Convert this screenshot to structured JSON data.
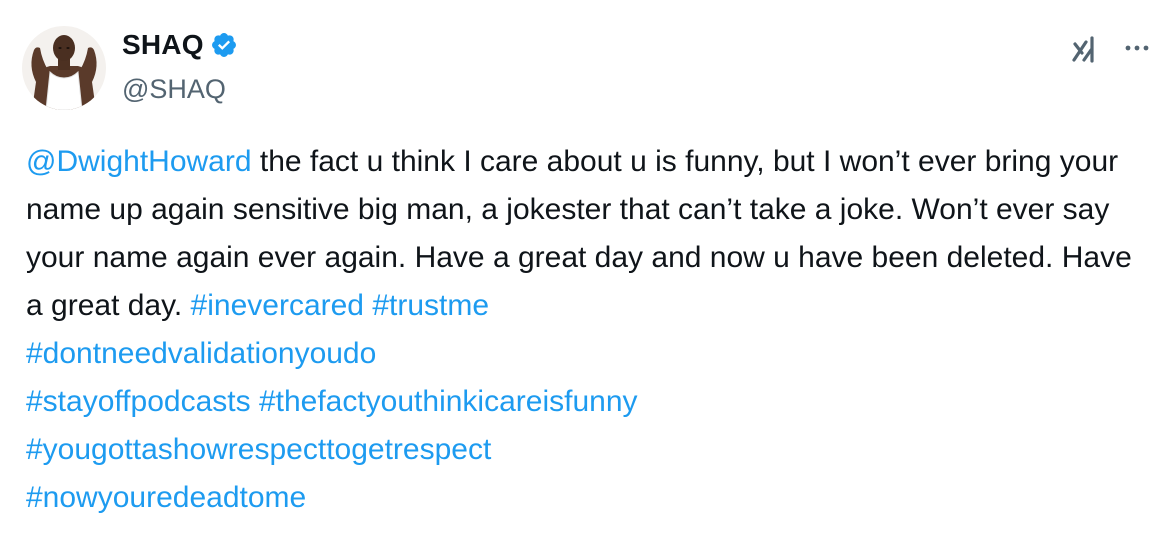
{
  "author": {
    "display_name": "SHAQ",
    "handle": "@SHAQ",
    "verified": true
  },
  "colors": {
    "link": "#1d9bf0",
    "verified": "#1d9bf0",
    "text": "#0f1419",
    "secondary": "#536471"
  },
  "icons": {
    "top_right": [
      "grok-icon",
      "more-icon"
    ],
    "badge": "verified-badge-icon"
  },
  "tweet": {
    "mention": "@DwightHoward",
    "text": " the fact u think I care about u is funny, but I won’t ever bring your name up again sensitive big man, a jokester that can’t take a joke. Won’t ever say your name again ever again. Have a great day and now u have been deleted. Have a great day. ",
    "hashtags": [
      "#inevercared",
      "#trustme",
      "#dontneedvalidationyoudo",
      "#stayoffpodcasts",
      "#thefactyouthinkicareisfunny",
      "#yougottashowrespecttogetrespect",
      "#nowyouredeadtome"
    ]
  }
}
